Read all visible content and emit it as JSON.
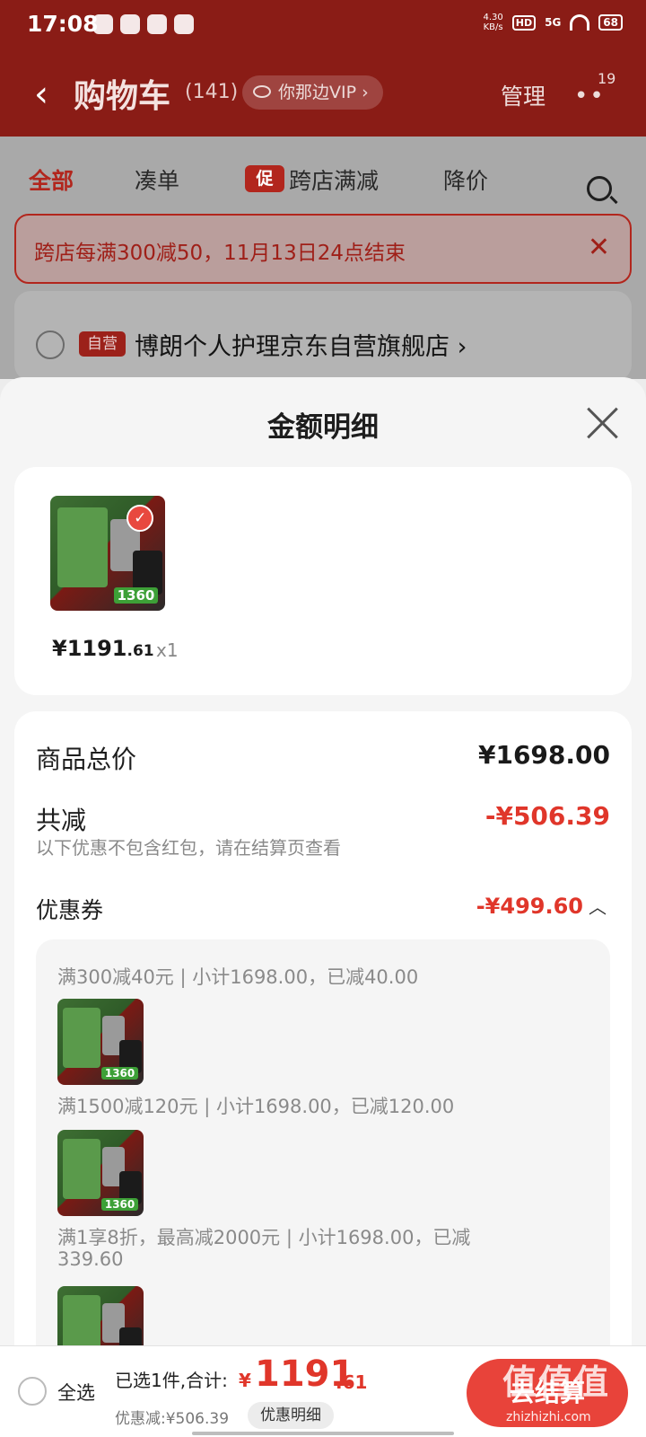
{
  "status_bar": {
    "time": "17:08",
    "net_speed": "4.30\nKB/s",
    "hd": "HD",
    "signal": "5G",
    "battery": "68"
  },
  "header": {
    "title": "购物车",
    "count": "(141)",
    "vip": "你那边VIP",
    "vip_chevron": "›",
    "manage": "管理",
    "more_badge": "19"
  },
  "tabs": [
    {
      "label": "全部",
      "active": true
    },
    {
      "label": "凑单"
    },
    {
      "label": "跨店满减",
      "tag": "促"
    },
    {
      "label": "降价"
    }
  ],
  "banner": {
    "text": "跨店每满300减50，11月13日24点结束"
  },
  "store": {
    "self_tag": "自营",
    "name": "博朗个人护理京东自营旗舰店 ›"
  },
  "sheet": {
    "title": "金额明细",
    "product": {
      "price_int": "¥1191",
      "price_dec": ".61",
      "qty": "x1",
      "thumb_price": "1360"
    },
    "total_label": "商品总价",
    "total_value": "¥1698.00",
    "reduce_label": "共减",
    "reduce_value": "-¥506.39",
    "note": "以下优惠不包含红包，请在结算页查看",
    "coupon_label": "优惠券",
    "coupon_value": "-¥499.60",
    "coupon_lines": [
      "满300减40元 | 小计1698.00，已减40.00",
      "满1500减120元 | 小计1698.00，已减120.00",
      "满1享8折，最高减2000元 | 小计1698.00，已减",
      "339.60"
    ]
  },
  "bottom": {
    "select_all": "全选",
    "summary": "已选1件,合计:",
    "yen": "¥",
    "total_int": "1191",
    "total_dec": ".61",
    "discount": "优惠减:¥506.39",
    "detail_button": "优惠明细",
    "checkout": "去结算"
  },
  "watermark": {
    "text": "值值值",
    "sub": "zhizhizhi.com"
  },
  "colors": {
    "header_bg": "#8a1c16",
    "accent_red": "#e0362a",
    "checkout_red": "#e8433a"
  }
}
